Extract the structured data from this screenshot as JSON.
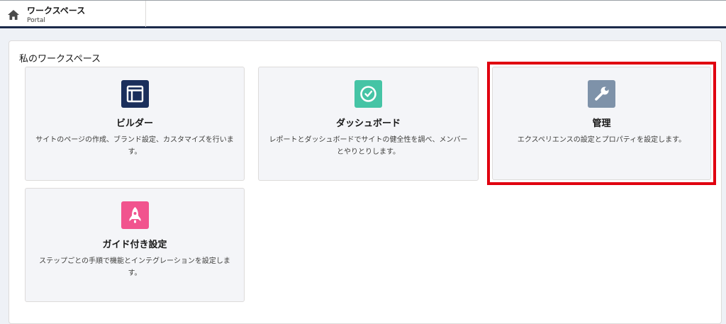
{
  "header": {
    "title": "ワークスペース",
    "subtitle": "Portal",
    "home_icon": "home-icon"
  },
  "section": {
    "title": "私のワークスペース"
  },
  "cards": [
    {
      "name": "ビルダー",
      "description": "サイトのページの作成、ブランド設定、カスタマイズを行います。",
      "icon": "builder-layout-icon",
      "color": "#1b2f5c"
    },
    {
      "name": "ダッシュボード",
      "description": "レポートとダッシュボードでサイトの健全性を調べ、メンバーとやりとりします。",
      "icon": "dashboard-gauge-icon",
      "color": "#45c4a5"
    },
    {
      "name": "管理",
      "description": "エクスペリエンスの設定とプロパティを設定します。",
      "icon": "wrench-icon",
      "color": "#7e92a9"
    },
    {
      "name": "ガイド付き設定",
      "description": "ステップごとの手順で機能とインテグレーションを設定します。",
      "icon": "rocket-icon",
      "color": "#f1548e"
    }
  ],
  "highlight_color": "#e0000f"
}
